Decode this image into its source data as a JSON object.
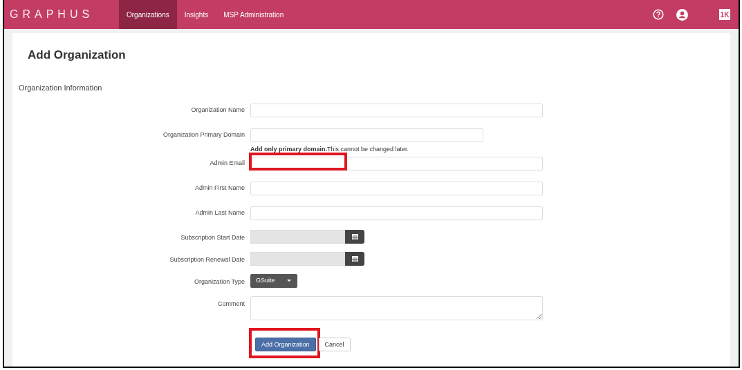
{
  "header": {
    "logo": "GRAPHUS",
    "nav": [
      {
        "label": "Organizations",
        "selected": true
      },
      {
        "label": "Insights",
        "selected": false
      },
      {
        "label": "MSP Administration",
        "selected": false
      }
    ],
    "badge": "1K"
  },
  "page_title": "Add Organization",
  "section_title": "Organization Information",
  "fields": [
    {
      "kind": "text",
      "label": "Organization Name",
      "highlighted": false
    },
    {
      "kind": "short-text",
      "label": "Organization Primary Domain",
      "highlighted": false,
      "help": "**Add only primary domain.**This cannot be changed later."
    },
    {
      "kind": "text",
      "label": "Admin Email",
      "highlighted": true
    },
    {
      "kind": "text",
      "label": "Admin First Name",
      "highlighted": false
    },
    {
      "kind": "text",
      "label": "Admin Last Name",
      "highlighted": false
    },
    {
      "kind": "date",
      "label": "Subscription Start Date",
      "disabled": true
    },
    {
      "kind": "date",
      "label": "Subscription Renewal Date",
      "disabled": true
    },
    {
      "kind": "select",
      "label": "Organization Type",
      "value": "GSuite"
    },
    {
      "kind": "textarea",
      "label": "Comment"
    }
  ],
  "buttons": [
    {
      "label": "Add Organization",
      "kind": "primary",
      "highlighted": true
    },
    {
      "label": "Cancel",
      "kind": "default",
      "highlighted": false
    }
  ]
}
